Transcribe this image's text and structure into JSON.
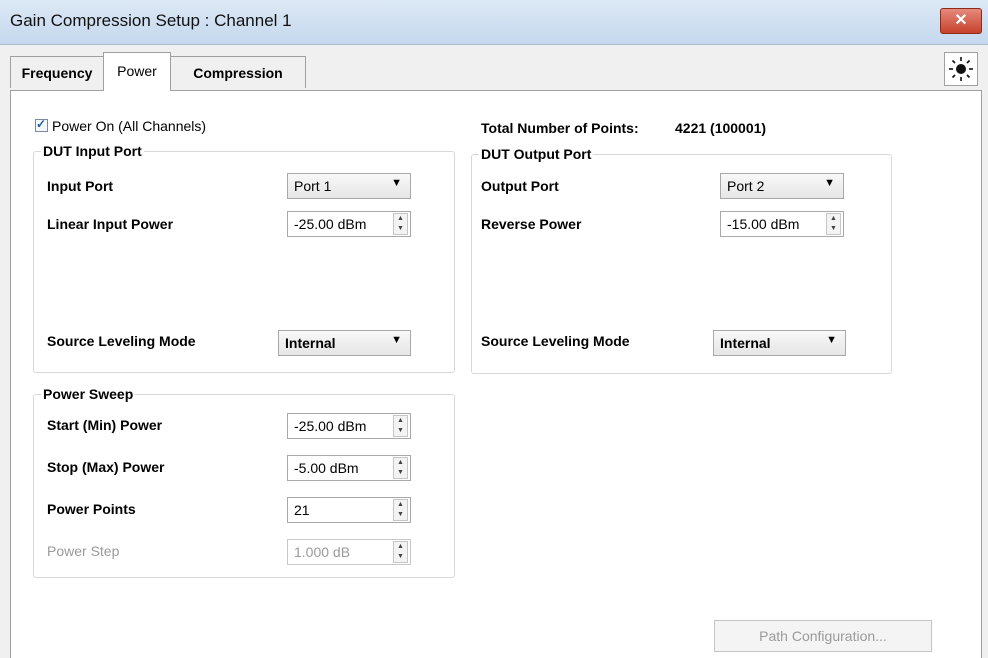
{
  "window": {
    "title": "Gain Compression Setup : Channel 1",
    "close_symbol": "✕"
  },
  "tabs": [
    {
      "label": "Frequency",
      "active": false
    },
    {
      "label": "Power",
      "active": true
    },
    {
      "label": "Compression",
      "active": false
    }
  ],
  "power_on": {
    "label": "Power On (All Channels)",
    "checked": true
  },
  "total_points": {
    "label": "Total Number of Points:",
    "value": "4221 (100001)"
  },
  "dut_input": {
    "title": "DUT Input Port",
    "input_port_label": "Input Port",
    "input_port_value": "Port 1",
    "linear_input_power_label": "Linear Input Power",
    "linear_input_power_value": "-25.00 dBm",
    "source_leveling_label": "Source Leveling Mode",
    "source_leveling_value": "Internal"
  },
  "dut_output": {
    "title": "DUT Output Port",
    "output_port_label": "Output Port",
    "output_port_value": "Port 2",
    "reverse_power_label": "Reverse Power",
    "reverse_power_value": "-15.00 dBm",
    "source_leveling_label": "Source Leveling Mode",
    "source_leveling_value": "Internal"
  },
  "power_sweep": {
    "title": "Power Sweep",
    "start_label": "Start (Min) Power",
    "start_value": "-25.00 dBm",
    "stop_label": "Stop (Max) Power",
    "stop_value": "-5.00 dBm",
    "points_label": "Power Points",
    "points_value": "21",
    "step_label": "Power Step",
    "step_value": "1.000 dB"
  },
  "path_config_button": "Path Configuration...",
  "icons": {
    "help": "sun-help-icon",
    "close": "close-icon",
    "dropdown": "chevron-down-icon",
    "spin": "spin-arrows-icon"
  },
  "colors": {
    "title_bar": "#c5d8ee",
    "close_button": "#c8412b",
    "checkbox_mark": "#1c5d9a"
  }
}
